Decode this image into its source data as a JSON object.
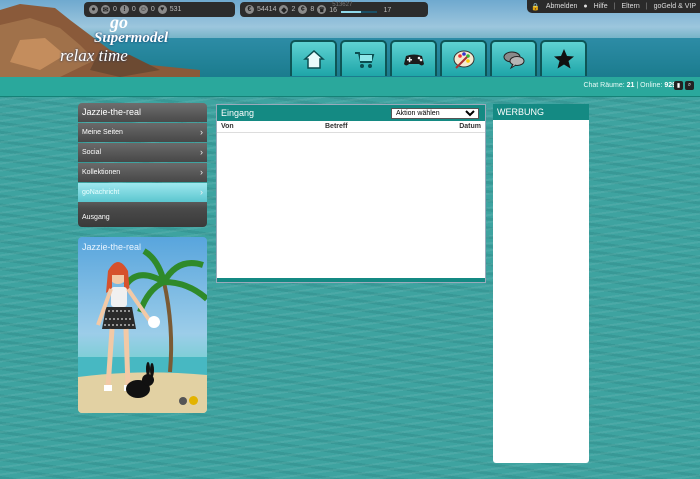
{
  "logo": {
    "go": "go",
    "supermodel": "Supermodel",
    "relax": "relax time"
  },
  "top_links": {
    "logout": "Abmelden",
    "help": "Hilfe",
    "parents": "Eltern",
    "vip": "goGeld & VIP"
  },
  "nav_tabs": [
    {
      "name": "home",
      "icon": "house-icon"
    },
    {
      "name": "shop",
      "icon": "shopping-cart-icon"
    },
    {
      "name": "games",
      "icon": "gamepad-icon"
    },
    {
      "name": "creative",
      "icon": "palette-icon"
    },
    {
      "name": "chat",
      "icon": "speech-bubbles-icon"
    },
    {
      "name": "stars",
      "icon": "star-icon"
    }
  ],
  "stats": {
    "mail": "0",
    "alerts": "0",
    "friends": "0",
    "likes": "531",
    "money": "54414",
    "diamonds": "2",
    "coins": "8"
  },
  "level": {
    "xp_text": "513627",
    "current": "16",
    "next": "17",
    "progress": 0.55
  },
  "chat_info": {
    "label": "Chat Räume:",
    "rooms": "21",
    "online_label": "Online:",
    "online": "929"
  },
  "sidebar": {
    "username": "Jazzie-the-real",
    "items": [
      {
        "label": "Meine Seiten",
        "active": false
      },
      {
        "label": "Social",
        "active": false
      },
      {
        "label": "Kollektionen",
        "active": false
      },
      {
        "label": "goNachricht",
        "active": true
      }
    ],
    "outbox": "Ausgang"
  },
  "avatar_name": "Jazzie-the-real",
  "inbox": {
    "title": "Eingang",
    "action_placeholder": "Aktion wählen",
    "columns": {
      "from": "Von",
      "subject": "Betreff",
      "date": "Datum"
    }
  },
  "ad": {
    "title": "WERBUNG"
  },
  "colors": {
    "teal_header": "#148a83",
    "accent": "#2aa89c",
    "active_menu": "#5bc6cf"
  }
}
